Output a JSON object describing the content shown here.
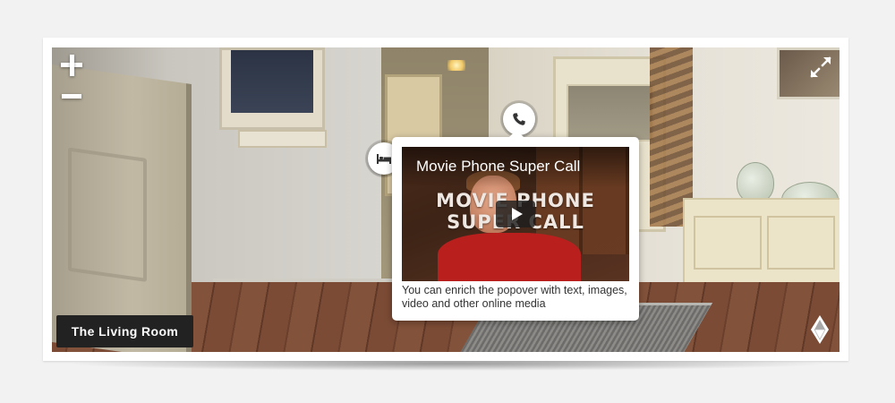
{
  "viewer": {
    "scene_name": "The Living Room",
    "controls": {
      "zoom_in_icon": "plus-icon",
      "zoom_out_icon": "minus-icon",
      "fullscreen_icon": "expand-arrows-icon",
      "compass_icon": "compass-icon"
    },
    "hotspots": [
      {
        "icon": "phone-icon"
      },
      {
        "icon": "bed-icon"
      }
    ],
    "popover": {
      "video_title": "Movie Phone Super Call",
      "video_overlay_text": "MOVIE PHONE\nSUPER CALL",
      "play_icon": "play-icon",
      "description": "You can enrich the popover with text, images, video and other online media"
    }
  },
  "colors": {
    "label_background": "#222222",
    "control_white": "#ffffff",
    "shirt_red": "#b9201d"
  }
}
